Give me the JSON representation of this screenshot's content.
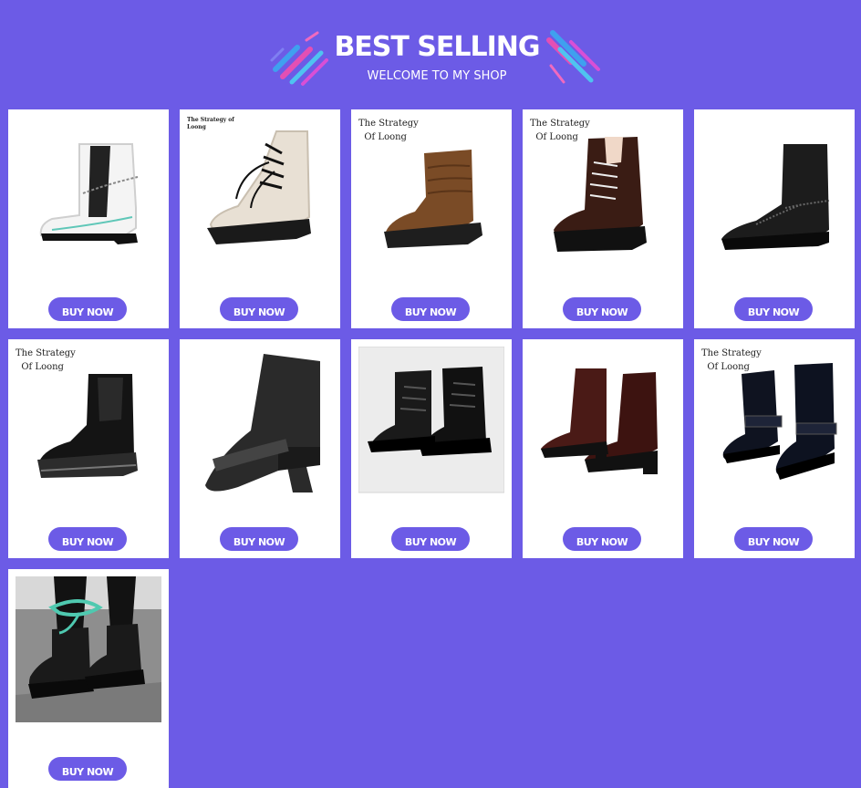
{
  "header": {
    "title": "BEST SELLING",
    "subtitle": "WELCOME TO MY SHOP"
  },
  "products": [
    {
      "image": "white-chelsea-boot-with-chain",
      "button_label": "BUY NOW",
      "watermark": ""
    },
    {
      "image": "cream-lace-up-ankle-boot",
      "button_label": "BUY NOW",
      "watermark": "The Strategy of\nLoong"
    },
    {
      "image": "brown-slouch-ankle-boot",
      "button_label": "BUY NOW",
      "watermark": "The Strategy\n  Of Loong"
    },
    {
      "image": "brown-lace-up-combat-boot",
      "button_label": "BUY NOW",
      "watermark": "The Strategy\n  Of Loong"
    },
    {
      "image": "black-square-toe-boot-with-chain",
      "button_label": "BUY NOW",
      "watermark": ""
    },
    {
      "image": "black-patent-chelsea-boot",
      "button_label": "BUY NOW",
      "watermark": "The Strategy\n  Of Loong"
    },
    {
      "image": "black-suede-pointed-boot",
      "button_label": "BUY NOW",
      "watermark": ""
    },
    {
      "image": "black-lace-up-platform-boots",
      "button_label": "BUY NOW",
      "watermark": ""
    },
    {
      "image": "burgundy-western-boots",
      "button_label": "BUY NOW",
      "watermark": ""
    },
    {
      "image": "black-buckle-strap-boots",
      "button_label": "BUY NOW",
      "watermark": "The Strategy\n  Of Loong"
    },
    {
      "image": "black-chunky-sole-boots-worn",
      "button_label": "BUY NOW",
      "watermark": ""
    }
  ],
  "colors": {
    "background": "#6c5be6",
    "card": "#ffffff",
    "button": "#6c5be6",
    "button_text": "#ffffff"
  }
}
